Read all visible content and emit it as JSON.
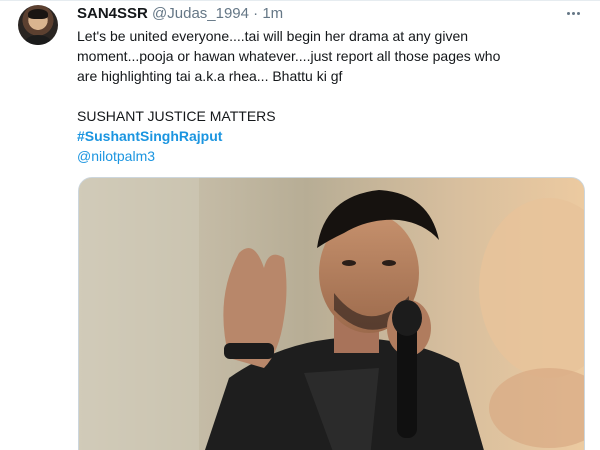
{
  "tweet": {
    "display_name": "SAN4SSR",
    "handle": "@Judas_1994",
    "separator": "·",
    "time": "1m",
    "text_line": "Let's be united everyone....tai will begin her drama at any given moment...pooja or hawan whatever....just report all those pages who are highlighting tai a.k.a rhea... Bhattu ki gf",
    "tagline": "SUSHANT JUSTICE MATTERS",
    "hashtag": "#SushantSinghRajput",
    "mention": "@nilotpalm3"
  },
  "icons": {
    "more": "more-horizontal-icon"
  },
  "colors": {
    "link": "#1b95e0",
    "text": "#14171a",
    "secondary": "#657786"
  }
}
